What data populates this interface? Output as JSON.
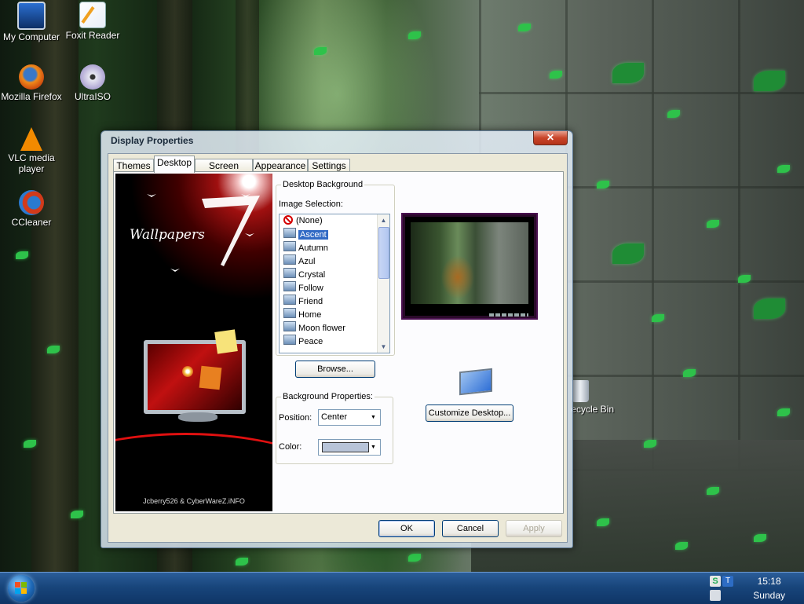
{
  "desktop": {
    "icons": [
      {
        "label": "My Computer",
        "icon": "computer-icon"
      },
      {
        "label": "Foxit Reader",
        "icon": "foxit-reader-icon"
      },
      {
        "label": "Mozilla Firefox",
        "icon": "firefox-icon"
      },
      {
        "label": "UltraISO",
        "icon": "disc-icon"
      },
      {
        "label": "VLC media player",
        "icon": "vlc-cone-icon"
      },
      {
        "label": "CCleaner",
        "icon": "ccleaner-icon"
      },
      {
        "label": "Recycle Bin",
        "visible_text": "ecycle Bin",
        "icon": "recycle-bin-icon"
      }
    ]
  },
  "window": {
    "title": "Display Properties",
    "close_label": "✕",
    "tabs": [
      {
        "label": "Themes",
        "active": false
      },
      {
        "label": "Desktop",
        "active": true
      },
      {
        "label": "Screen Saver",
        "active": false
      },
      {
        "label": "Appearance",
        "active": false
      },
      {
        "label": "Settings",
        "active": false
      }
    ],
    "art": {
      "big_text": "Wallpapers",
      "credit": "Jcberry526 & CyberWareZ.iNFO"
    },
    "desktop_background": {
      "group_title": "Desktop Background",
      "image_selection_label": "Image Selection:",
      "items": [
        "(None)",
        "Ascent",
        "Autumn",
        "Azul",
        "Crystal",
        "Follow",
        "Friend",
        "Home",
        "Moon flower",
        "Peace"
      ],
      "selected": "Ascent",
      "browse_label": "Browse..."
    },
    "background_properties": {
      "group_title": "Background Properties:",
      "position_label": "Position:",
      "position_value": "Center",
      "color_label": "Color:",
      "color_value": "#b8c4d8"
    },
    "customize_label": "Customize Desktop...",
    "buttons": {
      "ok": "OK",
      "cancel": "Cancel",
      "apply": "Apply"
    }
  },
  "taskbar": {
    "clock_time": "15:18",
    "clock_day": "Sunday"
  },
  "colors": {
    "selection": "#316ac5",
    "taskbar": "#18457b",
    "dialog_face": "#ece9d8"
  }
}
